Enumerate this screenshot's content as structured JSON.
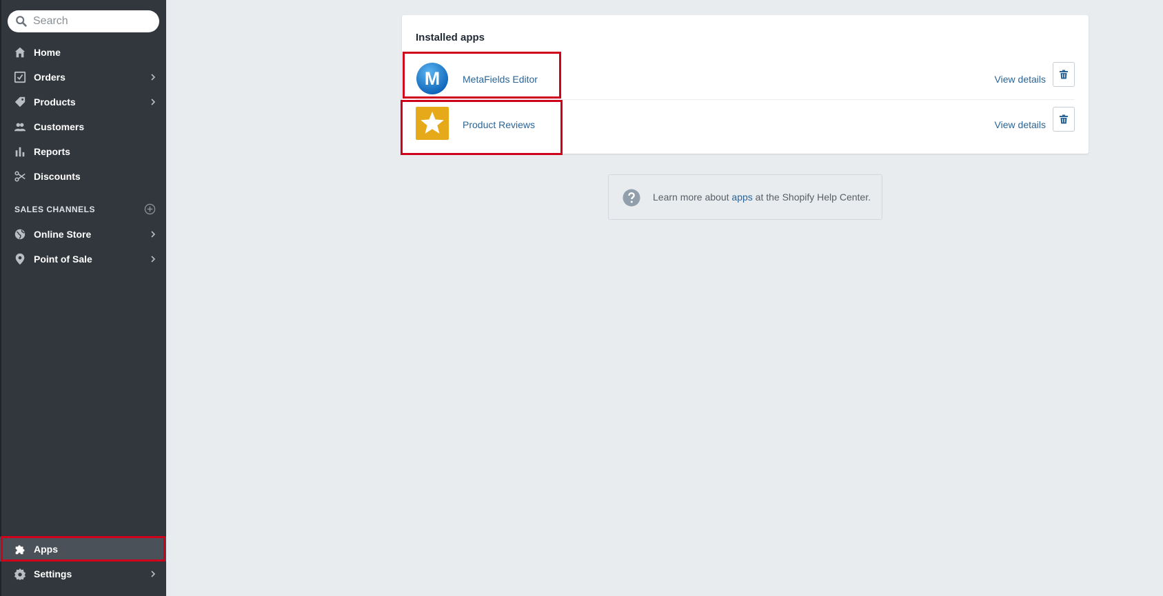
{
  "search": {
    "placeholder": "Search"
  },
  "sidebar": {
    "items": [
      {
        "label": "Home",
        "icon": "home-icon"
      },
      {
        "label": "Orders",
        "icon": "orders-icon"
      },
      {
        "label": "Products",
        "icon": "tag-icon"
      },
      {
        "label": "Customers",
        "icon": "customers-icon"
      },
      {
        "label": "Reports",
        "icon": "reports-icon"
      },
      {
        "label": "Discounts",
        "icon": "discounts-icon"
      }
    ],
    "section_title": "SALES CHANNELS",
    "channels": [
      {
        "label": "Online Store",
        "icon": "globe-icon"
      },
      {
        "label": "Point of Sale",
        "icon": "location-pin-icon"
      }
    ],
    "bottom": [
      {
        "label": "Apps",
        "icon": "puzzle-icon"
      },
      {
        "label": "Settings",
        "icon": "gear-icon"
      }
    ]
  },
  "card": {
    "title": "Installed apps",
    "apps": [
      {
        "name": "MetaFields Editor",
        "logo_letter": "M",
        "view_label": "View details"
      },
      {
        "name": "Product Reviews",
        "view_label": "View details"
      }
    ]
  },
  "help": {
    "prefix": "Learn more about ",
    "link": "apps",
    "suffix": " at the Shopify Help Center."
  },
  "colors": {
    "sidebar_bg": "#31373d",
    "link": "#2a6496",
    "highlight": "#d0021b",
    "reviews_logo": "#e6a919"
  }
}
